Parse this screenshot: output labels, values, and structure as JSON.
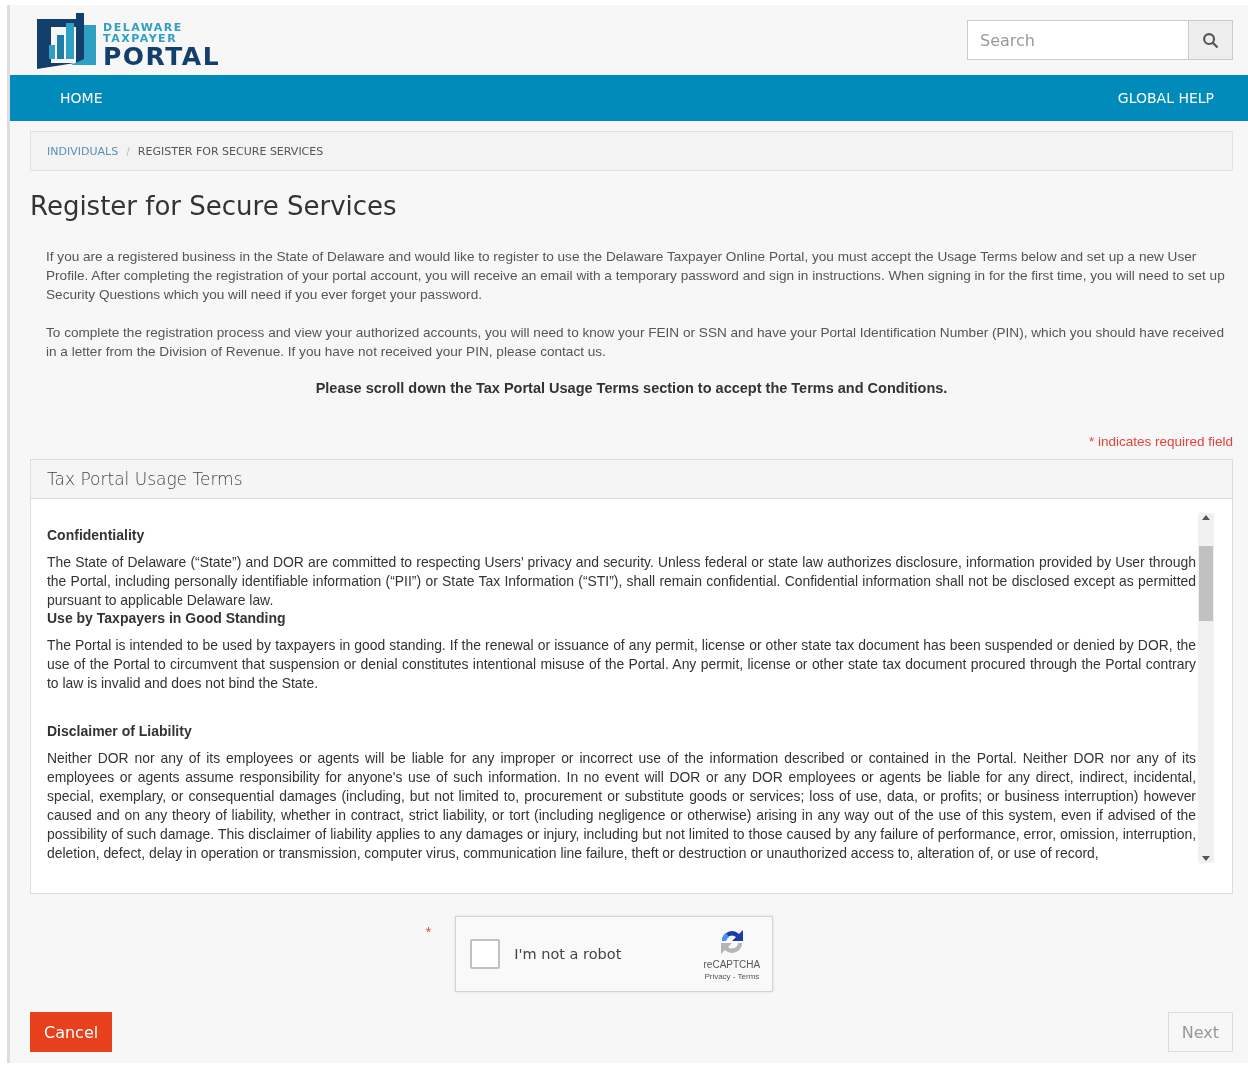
{
  "header": {
    "logo": {
      "line1": "DELAWARE",
      "line2": "TAXPAYER",
      "line3": "PORTAL"
    },
    "search": {
      "placeholder": "Search"
    }
  },
  "nav": {
    "items": [
      {
        "label": "HOME"
      },
      {
        "label": "GLOBAL HELP"
      }
    ]
  },
  "breadcrumb": [
    {
      "label": "INDIVIDUALS",
      "link": true
    },
    {
      "label": "REGISTER FOR SECURE SERVICES",
      "link": false
    }
  ],
  "breadcrumb_separator": "/",
  "page_title": "Register for Secure Services",
  "intro": [
    "If you are a registered business in the State of Delaware and would like to register to use the Delaware Taxpayer Online Portal, you must accept the Usage Terms below and set up a new User Profile. After completing the registration of your portal account, you will receive an email with a temporary password and sign in instructions. When signing in for the first time, you will need to set up Security Questions which you will need if you ever forget your password.",
    "To complete the registration process and view your authorized accounts, you will need to know your FEIN or SSN and have your Portal Identification Number (PIN), which you should have received in a letter from the Division of Revenue. If you have not received your PIN, please contact us."
  ],
  "notice": "Please scroll down the Tax Portal Usage Terms section to accept the Terms and Conditions.",
  "required_note": "* indicates required field",
  "terms": {
    "title": "Tax Portal Usage Terms",
    "sections": [
      {
        "heading": "Confidentiality",
        "body": "The State of Delaware (“State”) and DOR are committed to respecting Users’ privacy and security. Unless federal or state law authorizes disclosure, information provided by User through the Portal, including personally identifiable information (“PII”) or State Tax Information (“STI”), shall remain confidential. Confidential information shall not be disclosed except as permitted pursuant to applicable Delaware law.",
        "gap_before": false
      },
      {
        "heading": "Use by Taxpayers in Good Standing",
        "body": "The Portal is intended to be used by taxpayers in good standing. If the renewal or issuance of any permit, license or other state tax document has been suspended or denied by DOR, the use of the Portal to circumvent that suspension or denial constitutes intentional misuse of the Portal. Any permit, license or other state tax document procured through the Portal contrary to law is invalid and does not bind the State.",
        "gap_before": false
      },
      {
        "heading": "Disclaimer of Liability",
        "body": "Neither DOR nor any of its employees or agents will be liable for any improper or incorrect use of the information described or contained in the Portal. Neither DOR nor any of its employees or agents assume responsibility for anyone's use of such information. In no event will DOR or any DOR employees or agents be liable for any direct, indirect, incidental, special, exemplary, or consequential damages (including, but not limited to, procurement or substitute goods or services; loss of use, data, or profits; or business interruption) however caused and on any theory of liability, whether in contract, strict liability, or tort (including negligence or otherwise) arising in any way out of the use of this system, even if advised of the possibility of such damage. This disclaimer of liability applies to any damages or injury, including but not limited to those caused by any failure of performance, error, omission, interruption, deletion, defect, delay in operation or transmission, computer virus, communication line failure, theft or destruction or unauthorized access to, alteration of, or use of record,",
        "gap_before": true
      }
    ]
  },
  "captcha": {
    "required_mark": "*",
    "label": "I'm not a robot",
    "checked": false,
    "brand": "reCAPTCHA",
    "links": "Privacy - Terms"
  },
  "buttons": [
    {
      "kind": "cancel",
      "label": "Cancel"
    },
    {
      "kind": "next",
      "label": "Next"
    }
  ]
}
